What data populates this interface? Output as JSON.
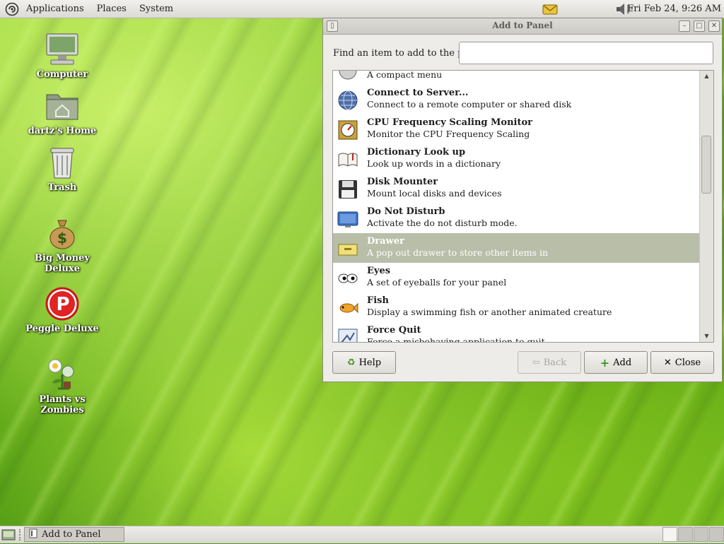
{
  "top_panel": {
    "menus": [
      "Applications",
      "Places",
      "System"
    ],
    "clock": "Fri Feb 24,  9:26 AM"
  },
  "desktop": {
    "icons": [
      {
        "label": "Computer",
        "icon": "computer-icon"
      },
      {
        "label": "dartz's Home",
        "icon": "home-folder-icon"
      },
      {
        "label": "Trash",
        "icon": "trash-icon"
      },
      {
        "label": "Big Money Deluxe",
        "icon": "money-bag-icon"
      },
      {
        "label": "Peggle Deluxe",
        "icon": "peggle-icon"
      },
      {
        "label": "Plants vs Zombies",
        "icon": "plants-icon"
      }
    ]
  },
  "dialog": {
    "title": "Add to Panel",
    "find_label": "Find an item to add to the panel:",
    "search_value": "",
    "items": [
      {
        "name": "",
        "desc": "A compact menu",
        "icon": "menu-icon"
      },
      {
        "name": "Connect to Server...",
        "desc": "Connect to a remote computer or shared disk",
        "icon": "globe-icon"
      },
      {
        "name": "CPU Frequency Scaling Monitor",
        "desc": "Monitor the CPU Frequency Scaling",
        "icon": "cpu-gauge-icon"
      },
      {
        "name": "Dictionary Look up",
        "desc": "Look up words in a dictionary",
        "icon": "dictionary-icon"
      },
      {
        "name": "Disk Mounter",
        "desc": "Mount local disks and devices",
        "icon": "floppy-icon"
      },
      {
        "name": "Do Not Disturb",
        "desc": "Activate the do not disturb mode.",
        "icon": "monitor-icon"
      },
      {
        "name": "Drawer",
        "desc": "A pop out drawer to store other items in",
        "icon": "drawer-icon",
        "selected": true
      },
      {
        "name": "Eyes",
        "desc": "A set of eyeballs for your panel",
        "icon": "eyes-icon"
      },
      {
        "name": "Fish",
        "desc": "Display a swimming fish or another animated creature",
        "icon": "fish-icon"
      },
      {
        "name": "Force Quit",
        "desc": "Force a misbehaving application to quit",
        "icon": "force-quit-icon"
      }
    ],
    "buttons": {
      "help": "Help",
      "back": "Back",
      "add": "Add",
      "close": "Close"
    }
  },
  "bottom_panel": {
    "task_label": "Add to Panel",
    "workspaces": 4,
    "active_workspace": 1
  },
  "colors": {
    "selection": "#b9bea8",
    "panel": "#dcdad5"
  }
}
